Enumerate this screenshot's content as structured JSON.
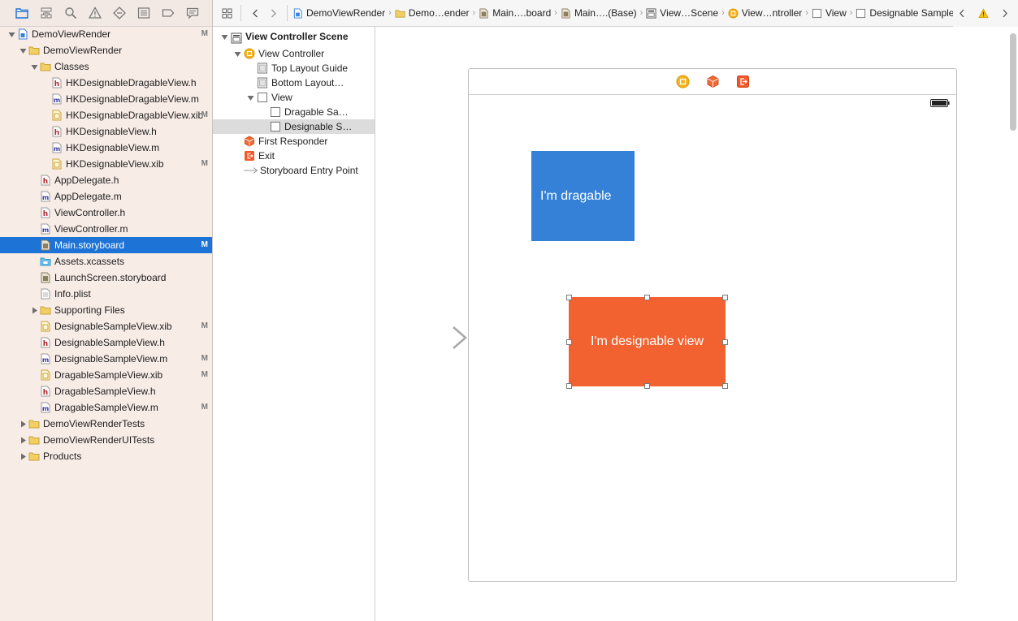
{
  "navigator": {
    "tabs": [
      "project-navigator",
      "symbol-navigator",
      "find-navigator",
      "issue-navigator",
      "test-navigator",
      "debug-navigator",
      "breakpoint-navigator",
      "report-navigator"
    ],
    "items": [
      {
        "label": "DemoViewRender",
        "icon": "project",
        "badge": "M",
        "disclosure": "open"
      },
      {
        "label": "DemoViewRender",
        "icon": "folder",
        "badge": "",
        "disclosure": "open"
      },
      {
        "label": "Classes",
        "icon": "folder",
        "badge": "",
        "disclosure": "open"
      },
      {
        "label": "HKDesignableDragableView.h",
        "icon": "h",
        "badge": ""
      },
      {
        "label": "HKDesignableDragableView.m",
        "icon": "m",
        "badge": ""
      },
      {
        "label": "HKDesignableDragableView.xib",
        "icon": "xib",
        "badge": "M"
      },
      {
        "label": "HKDesignableView.h",
        "icon": "h",
        "badge": ""
      },
      {
        "label": "HKDesignableView.m",
        "icon": "m",
        "badge": ""
      },
      {
        "label": "HKDesignableView.xib",
        "icon": "xib",
        "badge": "M"
      },
      {
        "label": "AppDelegate.h",
        "icon": "h",
        "badge": ""
      },
      {
        "label": "AppDelegate.m",
        "icon": "m",
        "badge": ""
      },
      {
        "label": "ViewController.h",
        "icon": "h",
        "badge": ""
      },
      {
        "label": "ViewController.m",
        "icon": "m",
        "badge": ""
      },
      {
        "label": "Main.storyboard",
        "icon": "storyboard",
        "badge": "M",
        "selected": true
      },
      {
        "label": "Assets.xcassets",
        "icon": "assets",
        "badge": ""
      },
      {
        "label": "LaunchScreen.storyboard",
        "icon": "storyboard",
        "badge": ""
      },
      {
        "label": "Info.plist",
        "icon": "plist",
        "badge": ""
      },
      {
        "label": "Supporting Files",
        "icon": "folder",
        "badge": "",
        "disclosure": "closed"
      },
      {
        "label": "DesignableSampleView.xib",
        "icon": "xib",
        "badge": "M"
      },
      {
        "label": "DesignableSampleView.h",
        "icon": "h",
        "badge": ""
      },
      {
        "label": "DesignableSampleView.m",
        "icon": "m",
        "badge": "M"
      },
      {
        "label": "DragableSampleView.xib",
        "icon": "xib",
        "badge": "M"
      },
      {
        "label": "DragableSampleView.h",
        "icon": "h",
        "badge": ""
      },
      {
        "label": "DragableSampleView.m",
        "icon": "m",
        "badge": "M"
      },
      {
        "label": "DemoViewRenderTests",
        "icon": "folder",
        "badge": "",
        "disclosure": "closed"
      },
      {
        "label": "DemoViewRenderUITests",
        "icon": "folder",
        "badge": "",
        "disclosure": "closed"
      },
      {
        "label": "Products",
        "icon": "folder",
        "badge": "",
        "disclosure": "closed"
      }
    ]
  },
  "jumpbar": {
    "crumbs": [
      {
        "label": "DemoViewRender",
        "icon": "project"
      },
      {
        "label": "Demo…ender",
        "icon": "folder"
      },
      {
        "label": "Main….board",
        "icon": "storyboard"
      },
      {
        "label": "Main….(Base)",
        "icon": "storyboard"
      },
      {
        "label": "View…Scene",
        "icon": "scene"
      },
      {
        "label": "View…ntroller",
        "icon": "viewcontroller"
      },
      {
        "label": "View",
        "icon": "view"
      },
      {
        "label": "Designable Sample View",
        "icon": "view"
      }
    ]
  },
  "outline": {
    "items": [
      {
        "label": "View Controller Scene",
        "icon": "scene",
        "type": "scene",
        "disclosure": "open"
      },
      {
        "label": "View Controller",
        "icon": "viewcontroller",
        "disclosure": "open"
      },
      {
        "label": "Top Layout Guide",
        "icon": "guide"
      },
      {
        "label": "Bottom Layout…",
        "icon": "guide"
      },
      {
        "label": "View",
        "icon": "view",
        "disclosure": "open"
      },
      {
        "label": "Dragable Sa…",
        "icon": "view"
      },
      {
        "label": "Designable S…",
        "icon": "view",
        "selected": true
      },
      {
        "label": "First Responder",
        "icon": "responder"
      },
      {
        "label": "Exit",
        "icon": "exit"
      },
      {
        "label": "Storyboard Entry Point",
        "icon": "entry"
      }
    ]
  },
  "canvas": {
    "dragable_label": "I'm dragable",
    "designable_label": "I'm designable view",
    "colors": {
      "dragable": "#3481d7",
      "designable": "#f26231"
    }
  }
}
